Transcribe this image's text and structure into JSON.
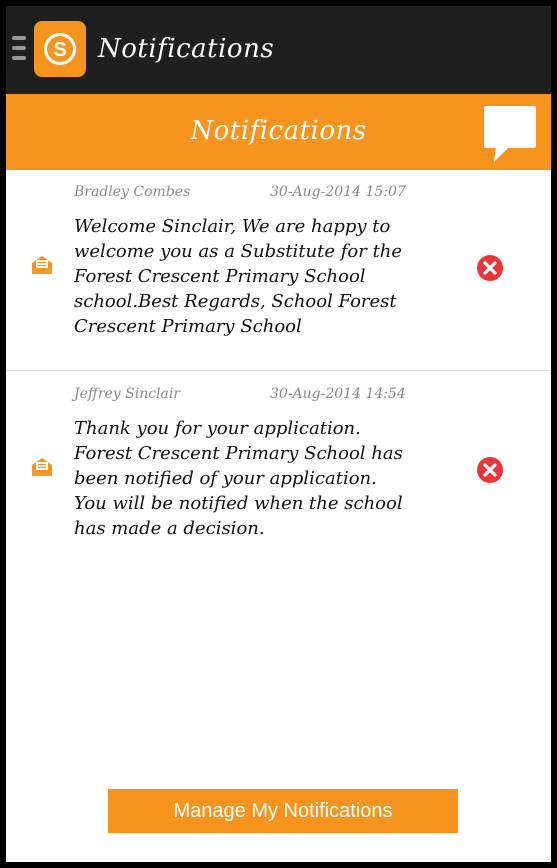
{
  "appbar": {
    "title": "Notifications",
    "logo_letter": "S",
    "menu_icon": "hamburger-menu-icon"
  },
  "header": {
    "title": "Notifications",
    "chat_icon": "speech-bubble-icon"
  },
  "notifications": [
    {
      "sender": "Bradley Combes",
      "date": "30-Aug-2014 15:07",
      "lines": [
        "Welcome Sinclair, We are happy to",
        "welcome you as a Substitute for the",
        "Forest Crescent Primary School",
        "school.Best Regards, School Forest",
        "Crescent Primary School"
      ]
    },
    {
      "sender": "Jeffrey Sinclair",
      "date": "30-Aug-2014 14:54",
      "lines": [
        "Thank you for your application.",
        "Forest Crescent Primary School has",
        "been notified of your application.",
        "You will be notified when the school",
        "has made a decision."
      ]
    }
  ],
  "footer": {
    "manage_label": "Manage My Notifications"
  },
  "colors": {
    "accent": "#f7941d",
    "appbar": "#1f1f1f",
    "delete": "#e8363b"
  }
}
